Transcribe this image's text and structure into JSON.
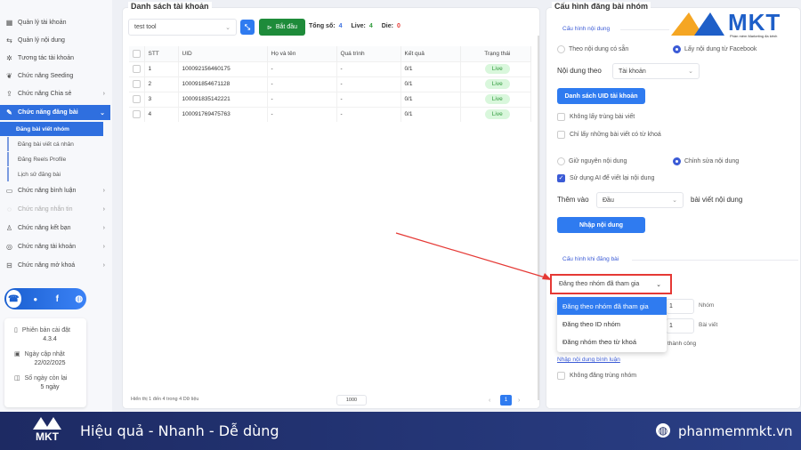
{
  "sidebar": {
    "items": [
      {
        "label": "Quản lý tài khoản",
        "icon": "grid-icon"
      },
      {
        "label": "Quản lý nội dung",
        "icon": "content-icon"
      },
      {
        "label": "Tương tác tài khoản",
        "icon": "interact-icon"
      },
      {
        "label": "Chức năng Seeding",
        "icon": "seeding-icon"
      },
      {
        "label": "Chức năng Chia sẻ",
        "icon": "share-icon"
      },
      {
        "label": "Chức năng đăng bài",
        "icon": "post-icon"
      },
      {
        "label": "Chức năng bình luận",
        "icon": "comment-icon"
      },
      {
        "label": "Chức năng nhắn tin",
        "icon": "message-icon"
      },
      {
        "label": "Chức năng kết bạn",
        "icon": "add-friend-icon"
      },
      {
        "label": "Chức năng tài khoản",
        "icon": "account-icon"
      },
      {
        "label": "Chức năng mở khoá",
        "icon": "unlock-icon"
      }
    ],
    "subitems": [
      "Đăng bài viết nhóm",
      "Đăng bài viết cá nhân",
      "Đăng Reels Profile",
      "Lịch sử đăng bài"
    ],
    "info": {
      "version_label": "Phiên bản cài đặt",
      "version": "4.3.4",
      "update_label": "Ngày cập nhật",
      "update": "22/02/2025",
      "days_label": "Số ngày còn lại",
      "days": "5 ngày"
    }
  },
  "accounts": {
    "title": "Danh sách tài khoản",
    "group_select": "test tool",
    "start_label": "Bắt đầu",
    "total_label": "Tổng số:",
    "total": "4",
    "live_label": "Live:",
    "live": "4",
    "die_label": "Die:",
    "die": "0",
    "columns": [
      "STT",
      "UID",
      "Họ và tên",
      "Quá trình",
      "Kết quả",
      "Trạng thái"
    ],
    "rows": [
      {
        "stt": "1",
        "uid": "100092156460175",
        "name": "-",
        "process": "-",
        "result": "0/1",
        "status": "Live"
      },
      {
        "stt": "2",
        "uid": "100091854671128",
        "name": "-",
        "process": "-",
        "result": "0/1",
        "status": "Live"
      },
      {
        "stt": "3",
        "uid": "100091835142221",
        "name": "-",
        "process": "-",
        "result": "0/1",
        "status": "Live"
      },
      {
        "stt": "4",
        "uid": "100091769475763",
        "name": "-",
        "process": "-",
        "result": "0/1",
        "status": "Live"
      }
    ],
    "footer_text": "Hiển thị 1 đến 4 trong 4 Dữ liệu",
    "page_size": "1000",
    "page": "1"
  },
  "config": {
    "title": "Cấu hình đăng bài nhóm",
    "content_section": "Cấu hình nội dung",
    "radio_available": "Theo nội dung có sẵn",
    "radio_facebook": "Lấy nội dung từ Facebook",
    "content_by_label": "Nội dung theo",
    "content_by_value": "Tài khoản",
    "uid_list_button": "Danh sách UID tài khoản",
    "no_duplicate": "Không lấy trùng bài viết",
    "keyword_only": "Chỉ lấy những bài viết có từ khoá",
    "keep_content": "Giữ nguyên nội dung",
    "edit_content": "Chỉnh sửa nội dung",
    "use_ai": "Sử dụng AI để viết lại nội dung",
    "add_to_label": "Thêm vào",
    "add_to_value": "Đầu",
    "add_to_suffix": "bài viết nội dung",
    "input_content_button": "Nhập nội dung",
    "post_section": "Cấu hình khi đăng bài",
    "post_mode": "Đăng theo nhóm đã tham gia",
    "post_mode_options": [
      "Đăng theo nhóm đã tham gia",
      "Đăng theo ID nhóm",
      "Đăng nhóm theo từ khoá"
    ],
    "group_count": "1",
    "group_unit": "Nhóm",
    "post_count": "1",
    "post_unit": "Bài viết",
    "success_text": "thành công",
    "comment_link": "Nhập nội dung bình luận",
    "no_dup_group": "Không đăng trùng nhóm"
  },
  "brand": {
    "logo": "MKT",
    "tagline_logo": "Phần mềm Marketing đa kênh",
    "slogan": "Hiệu quả - Nhanh - Dễ dùng",
    "website": "phanmemmkt.vn"
  },
  "colors": {
    "primary": "#2f7bf0",
    "start": "#1e8b3a",
    "annotation": "#e53935",
    "footer": "#1d2a63"
  }
}
